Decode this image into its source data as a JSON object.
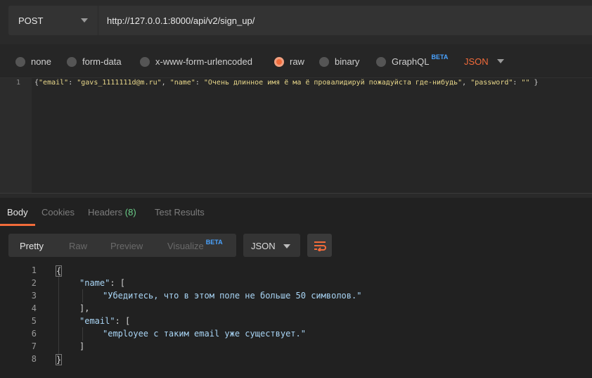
{
  "request": {
    "method": "POST",
    "url": "http://127.0.0.1:8000/api/v2/sign_up/"
  },
  "body_options": [
    {
      "label": "none",
      "selected": false
    },
    {
      "label": "form-data",
      "selected": false
    },
    {
      "label": "x-www-form-urlencoded",
      "selected": false
    },
    {
      "label": "raw",
      "selected": true
    },
    {
      "label": "binary",
      "selected": false
    },
    {
      "label": "GraphQL",
      "selected": false,
      "badge": "BETA"
    }
  ],
  "body_format": "JSON",
  "request_body": {
    "line_number": "1",
    "key_email": "\"email\"",
    "val_email": "\"gavs_1111111d@m.ru\"",
    "key_name": "\"name\"",
    "val_name": "\"Очень длинное имя ё ма ё провалидируй пожадуйста где-нибудь\"",
    "key_password": "\"password\"",
    "val_password": "\"\""
  },
  "response_tabs": [
    {
      "label": "Body",
      "active": true
    },
    {
      "label": "Cookies",
      "active": false
    },
    {
      "label": "Headers",
      "count": "(8)",
      "active": false
    },
    {
      "label": "Test Results",
      "active": false
    }
  ],
  "view_modes": [
    {
      "label": "Pretty",
      "active": true
    },
    {
      "label": "Raw",
      "active": false
    },
    {
      "label": "Preview",
      "active": false
    },
    {
      "label": "Visualize",
      "active": false,
      "badge": "BETA"
    }
  ],
  "response_format": "JSON",
  "response_lines": [
    {
      "n": "1",
      "text": "{"
    },
    {
      "n": "2",
      "key": "\"name\"",
      "rest": ": ["
    },
    {
      "n": "3",
      "str": "\"Убедитесь, что в этом поле не больше 50 символов.\""
    },
    {
      "n": "4",
      "text": "],"
    },
    {
      "n": "5",
      "key": "\"email\"",
      "rest": ": ["
    },
    {
      "n": "6",
      "str": "\"employee с таким email уже существует.\""
    },
    {
      "n": "7",
      "text": "]"
    },
    {
      "n": "8",
      "text": "}"
    }
  ],
  "colors": {
    "accent": "#f26b3a",
    "beta": "#4aa3ff",
    "count": "#6ccf8a"
  }
}
